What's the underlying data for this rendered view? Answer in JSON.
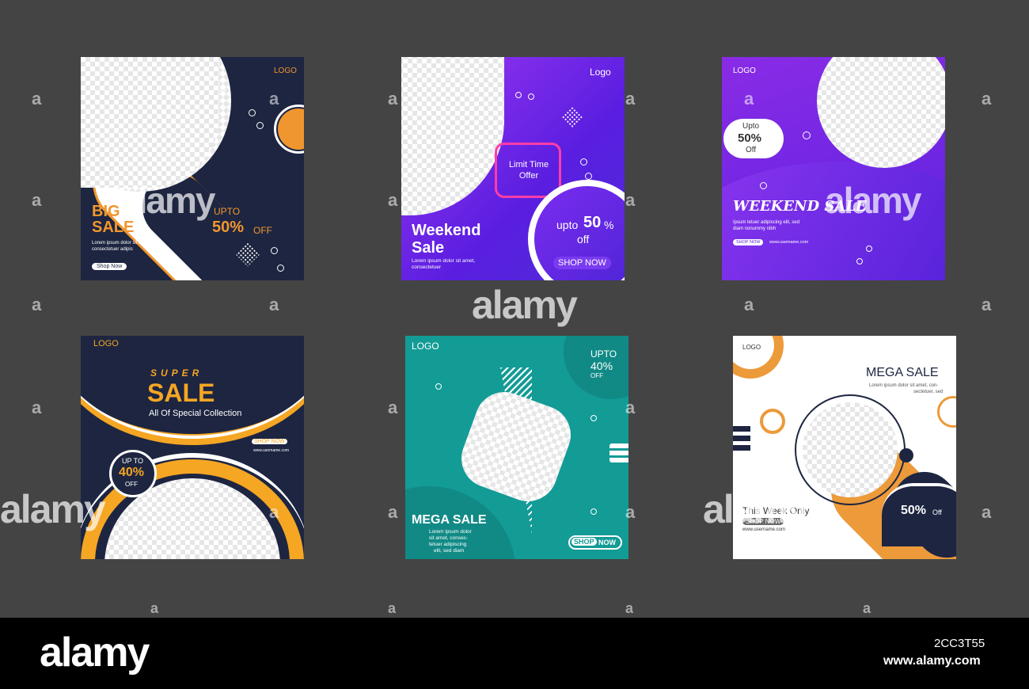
{
  "colors": {
    "background": "#444444",
    "navy": "#1d2541",
    "orange": "#f0962f",
    "purple": "#6f22e6",
    "teal": "#139b96",
    "pink": "#ff3da8"
  },
  "cards": {
    "c1": {
      "logo": "LOGO",
      "title1": "BIG",
      "title2": "SALE",
      "upto": "UPTO",
      "discount": "50%",
      "off": "OFF",
      "body1": "Lorem ipsum dolor sit amet,",
      "body2": "consectetuer adipis",
      "cta": "Shop Now"
    },
    "c2": {
      "logo": "Logo",
      "offer1": "Limit Time",
      "offer2": "Offer",
      "title1": "Weekend",
      "title2": "Sale",
      "body1": "Lorem ipsum dolor sit amet,",
      "body2": "consectetuer",
      "upto": "upto",
      "discount": "50",
      "pct": "%",
      "off": "off",
      "cta": "SHOP NOW"
    },
    "c3": {
      "logo": "LOGO",
      "upto": "Upto",
      "discount": "50%",
      "off": "Off",
      "title": "WEEKEND SALE",
      "body1": "Ipsum tetuer adipiscing elit, sed",
      "body2": "diam nonummy nibh",
      "cta": "SHOP NOW",
      "url": "www.usemame.com"
    },
    "c4": {
      "logo": "LOGO",
      "super": "SUPER",
      "sale": "SALE",
      "sub": "All Of Special Collection",
      "cta": "SHOP NOW",
      "url": "www.username.com",
      "upto": "UP TO",
      "discount": "40%",
      "off": "OFF"
    },
    "c5": {
      "logo": "LOGO",
      "upto": "UPTO",
      "discount": "40%",
      "off": "OFF",
      "title": "MEGA SALE",
      "body1": "Lorem ipsum dolor",
      "body2": "sit amet, consec-",
      "body3": "tetuer adipiscing",
      "body4": "elit, sed diam",
      "cta_a": "SHOP",
      "cta_b": "NOW"
    },
    "c6": {
      "logo": "LOGO",
      "title": "MEGA SALE",
      "body1": "Lorem ipsum dolor sit amet, con-",
      "body2": "sectetuer, sed",
      "week": "This Week Only",
      "cta": "SHOP NOW",
      "url": "www.username.com",
      "discount": "50%",
      "off": "Off"
    }
  },
  "watermark": {
    "brand": "alamy",
    "letter": "a",
    "image_id": "2CC3T55",
    "url": "www.alamy.com"
  }
}
